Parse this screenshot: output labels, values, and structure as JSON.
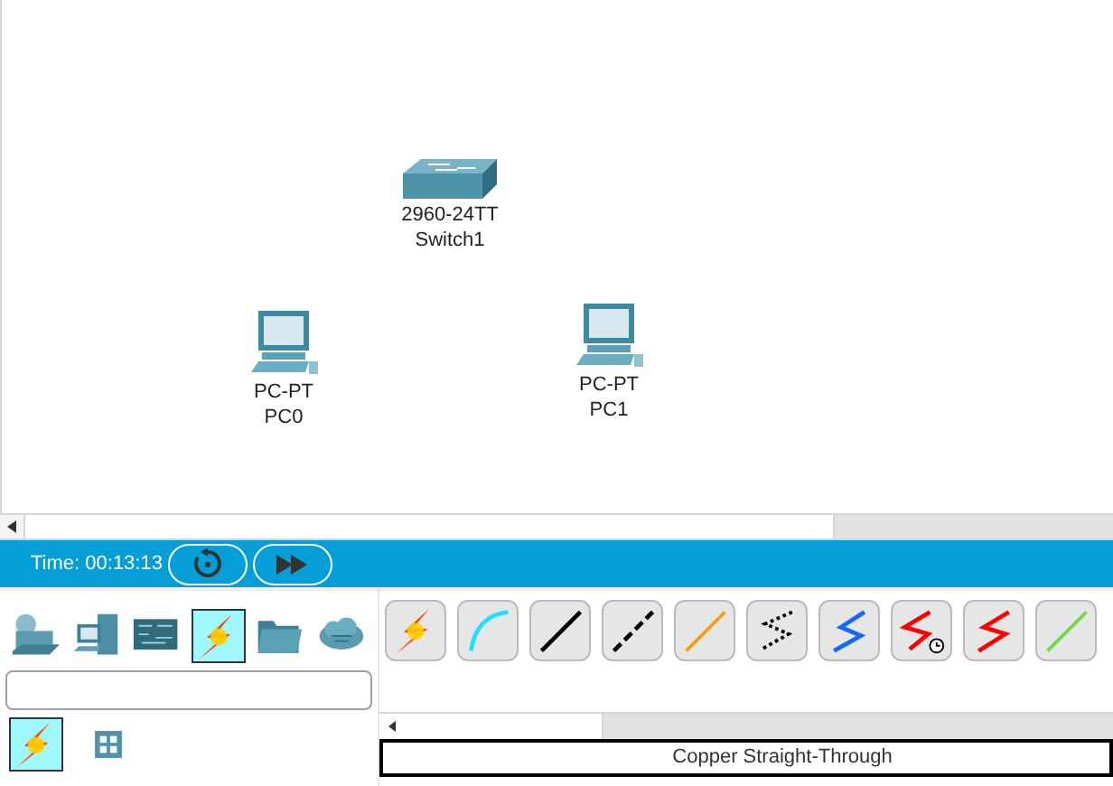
{
  "workspace": {
    "devices": [
      {
        "kind": "switch",
        "model": "2960-24TT",
        "name": "Switch1"
      },
      {
        "kind": "pc",
        "model": "PC-PT",
        "name": "PC0"
      },
      {
        "kind": "pc",
        "model": "PC-PT",
        "name": "PC1"
      }
    ]
  },
  "simulation_bar": {
    "time": "Time: 00:13:13"
  },
  "device_categories": [
    {
      "kind": "network",
      "selected": false
    },
    {
      "kind": "end",
      "selected": false
    },
    {
      "kind": "board",
      "selected": false
    },
    {
      "kind": "connections",
      "selected": true
    },
    {
      "kind": "folder",
      "selected": false
    },
    {
      "kind": "cloud",
      "selected": false
    }
  ],
  "subcategories": [
    {
      "kind": "connections",
      "selected": true
    },
    {
      "kind": "grid",
      "selected": false
    }
  ],
  "cables": [
    {
      "kind": "auto"
    },
    {
      "kind": "console"
    },
    {
      "kind": "straight"
    },
    {
      "kind": "cross"
    },
    {
      "kind": "fiber"
    },
    {
      "kind": "phone"
    },
    {
      "kind": "coaxial"
    },
    {
      "kind": "serial-dce"
    },
    {
      "kind": "serial-dte"
    },
    {
      "kind": "octal"
    }
  ],
  "selected_label": "Copper Straight-Through"
}
